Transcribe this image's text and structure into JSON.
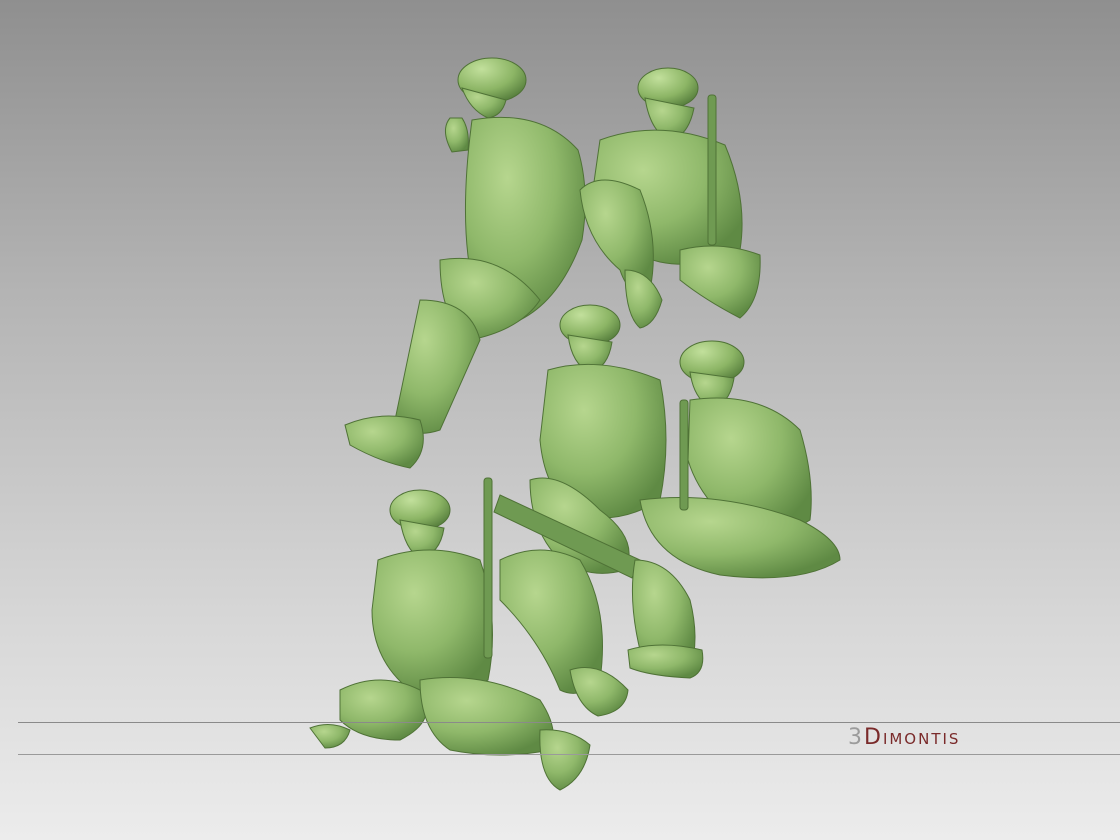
{
  "colors": {
    "figure": "#8fb86a",
    "figure_light": "#b6d68e",
    "figure_dark": "#5f8a44",
    "logo_number": "#9b9b9b",
    "logo_word": "#7a2a2a"
  },
  "logo": {
    "number": "3",
    "word": "Dimontis"
  },
  "figures": [
    {
      "name": "soldier-smoking-seated"
    },
    {
      "name": "soldier-with-smg-seated"
    },
    {
      "name": "soldier-with-mg-ammo-belts"
    },
    {
      "name": "soldier-seated-with-rifle-back"
    },
    {
      "name": "soldier-sitting-ground-with-rifle"
    }
  ]
}
